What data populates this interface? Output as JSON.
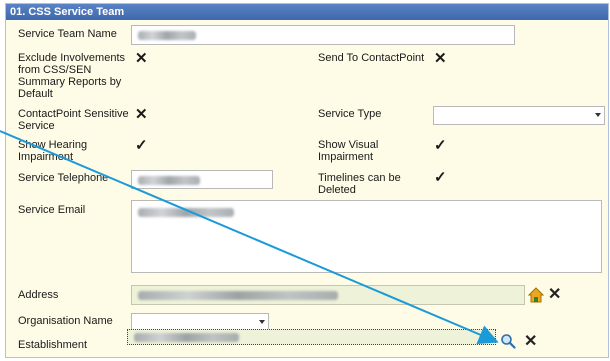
{
  "panel": {
    "title": "01. CSS Service Team"
  },
  "fields": {
    "service_team_name": {
      "label": "Service Team Name"
    },
    "exclude_involvements": {
      "label": "Exclude Involvements from CSS/SEN Summary Reports by Default",
      "checked": true
    },
    "send_to_contactpoint": {
      "label": "Send To ContactPoint",
      "checked": true
    },
    "contactpoint_sensitive": {
      "label": "ContactPoint Sensitive Service",
      "checked": true
    },
    "service_type": {
      "label": "Service Type",
      "value": ""
    },
    "show_hearing": {
      "label": "Show Hearing Impairment",
      "checked": true
    },
    "show_visual": {
      "label": "Show Visual Impairment",
      "checked": true
    },
    "service_telephone": {
      "label": "Service Telephone"
    },
    "timelines_deleted": {
      "label": "Timelines can be Deleted",
      "checked": true
    },
    "service_email": {
      "label": "Service Email"
    },
    "address": {
      "label": "Address"
    },
    "organisation_name": {
      "label": "Organisation Name",
      "value": ""
    },
    "establishment": {
      "label": "Establishment"
    }
  },
  "icons": {
    "x_mark": "✕",
    "check_mark": "✓",
    "home": "home-icon",
    "search": "search-icon",
    "clear": "close-icon"
  },
  "colors": {
    "header": "#4a73b8",
    "panel_bg": "#fefbe6",
    "arrow": "#1a9ad9",
    "home_icon": "#e2a21b"
  }
}
